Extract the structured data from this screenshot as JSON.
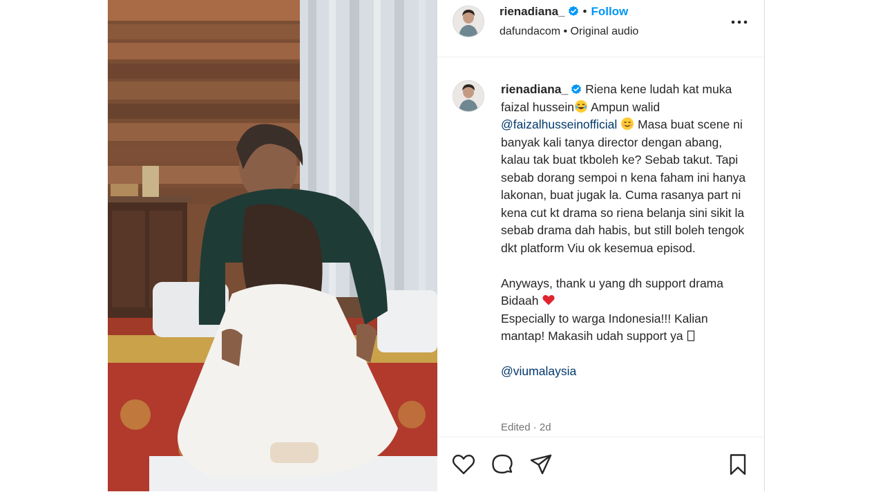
{
  "header": {
    "username": "rienadiana_",
    "separator": "•",
    "follow_label": "Follow",
    "audio_line": "dafundacom • Original audio"
  },
  "caption": {
    "username": "rienadiana_",
    "text_1": " Riena kene ludah kat muka faizal hussein",
    "text_2": " Ampun walid ",
    "mention_1": "@faizalhusseinofficial",
    "text_3": " Masa buat scene ni banyak kali tanya director dengan abang, kalau tak buat tkboleh ke? Sebab takut. Tapi sebab dorang sempoi n kena faham ini hanya lakonan, buat jugak la. Cuma rasanya part ni kena cut kt drama so riena belanja sini sikit la sebab drama dah habis, but still boleh tengok dkt platform Viu ok kesemua episod.\n\nAnyways, thank u yang dh support drama Bidaah ",
    "text_4": "\nEspecially to warga Indonesia!!! Kalian mantap! Makasih udah support ya ",
    "text_5": "\n\n",
    "mention_2": "@viumalaysia",
    "edited": "Edited · 2d"
  },
  "colors": {
    "accent": "#0095f6",
    "mention": "#00376b",
    "muted": "#737373",
    "verified": "#0095f6"
  },
  "icons": [
    "verified-icon",
    "more-options-icon",
    "heart-icon",
    "comment-icon",
    "share-icon",
    "bookmark-icon"
  ]
}
